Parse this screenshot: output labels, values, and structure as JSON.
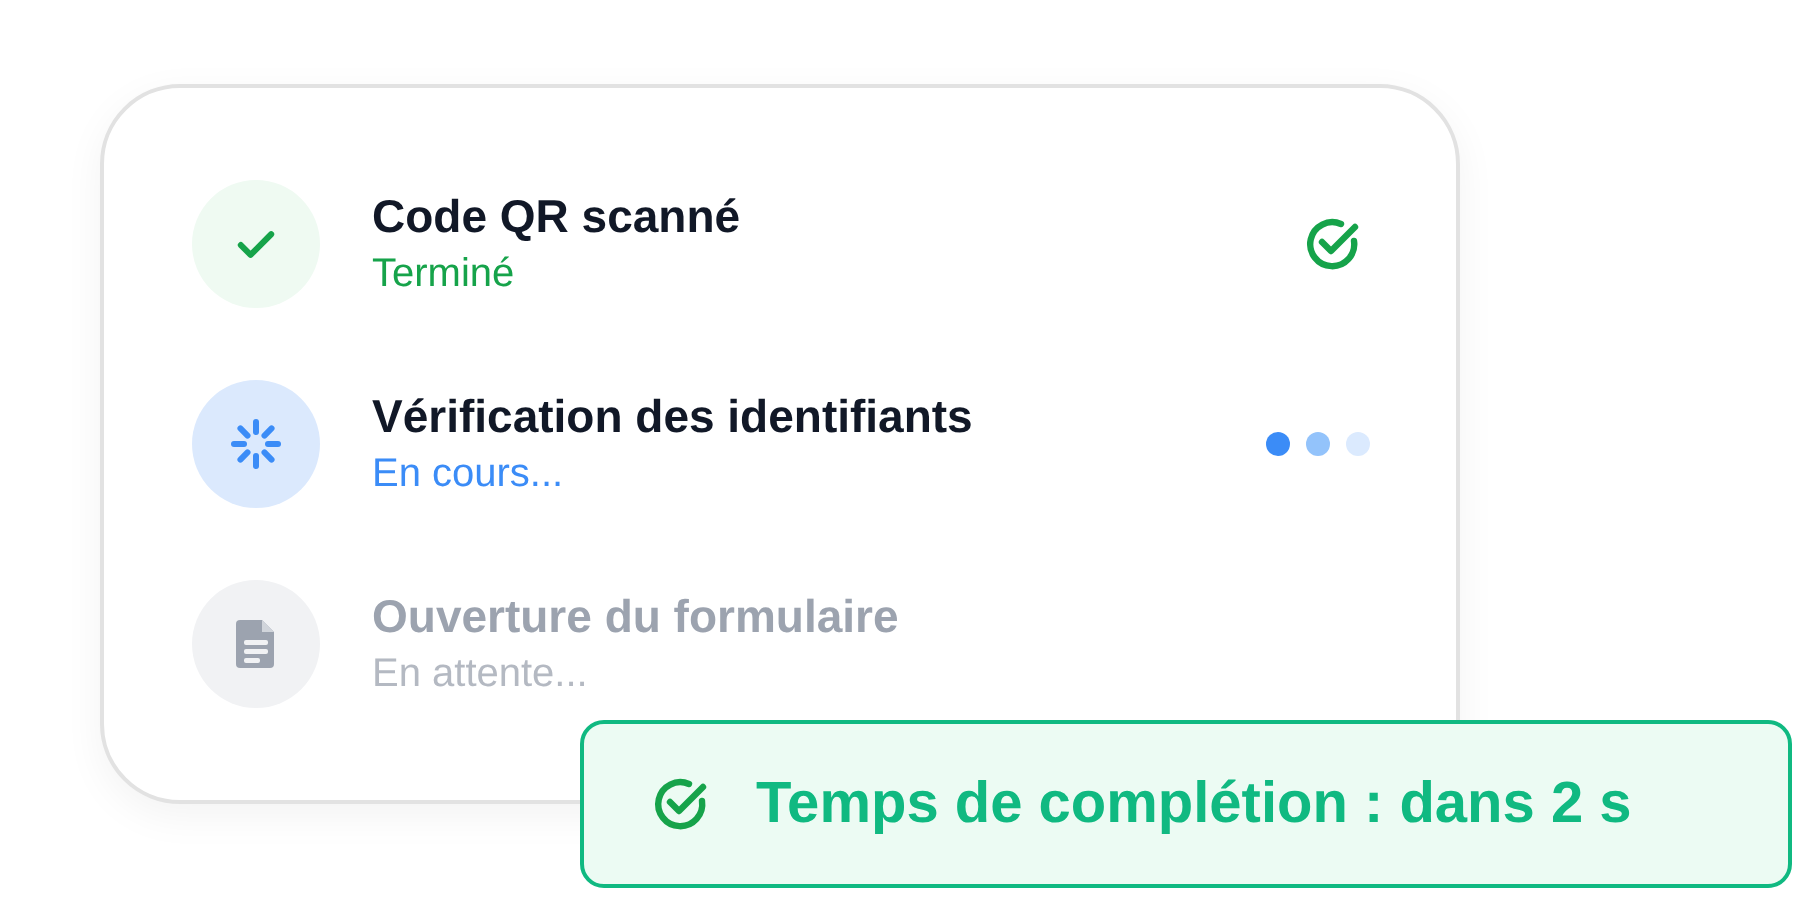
{
  "steps": [
    {
      "kind": "done",
      "title": "Code QR scanné",
      "status": "Terminé"
    },
    {
      "kind": "active",
      "title": "Vérification des identifiants",
      "status": "En cours..."
    },
    {
      "kind": "pending",
      "title": "Ouverture du formulaire",
      "status": "En attente..."
    }
  ],
  "toast": {
    "text": "Temps de complétion : dans 2 s"
  }
}
